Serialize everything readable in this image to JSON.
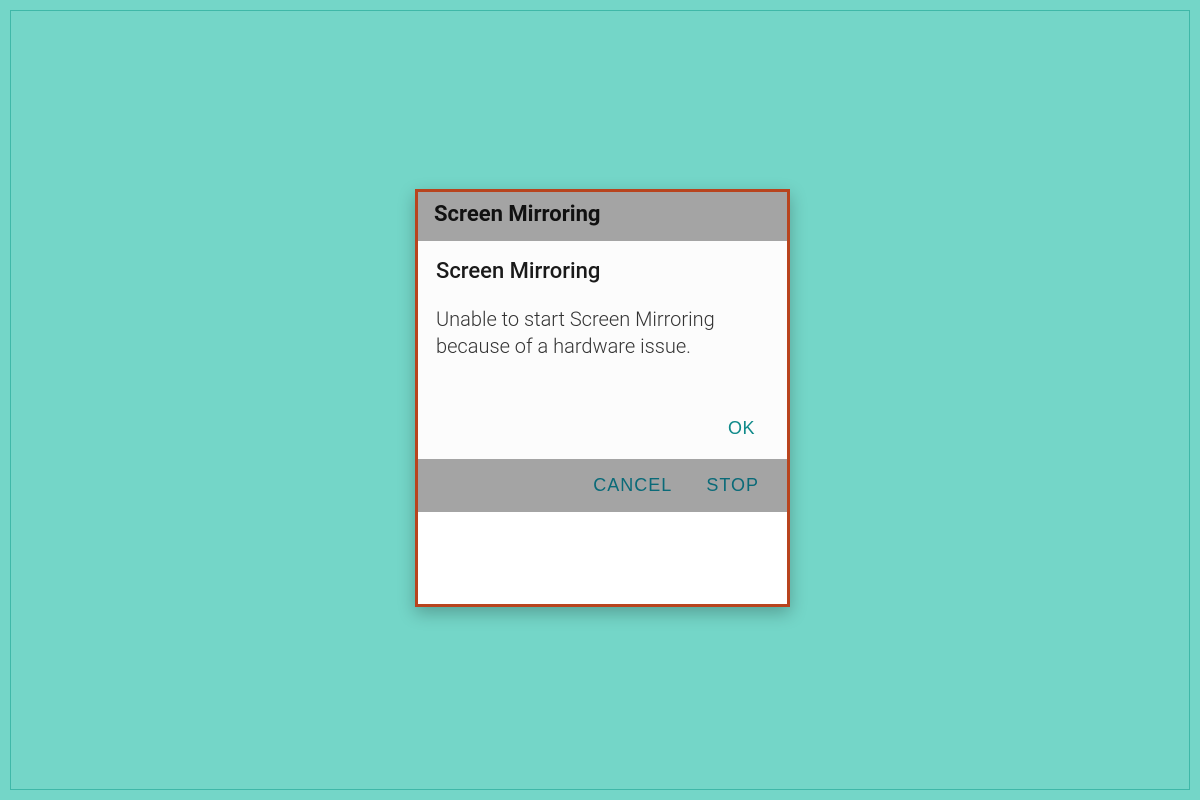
{
  "outer": {
    "title": "Screen Mirroring",
    "cancel_label": "CANCEL",
    "stop_label": "STOP"
  },
  "inner": {
    "title": "Screen Mirroring",
    "message": "Unable to start Screen Mirroring because of a hardware issue.",
    "ok_label": "OK"
  }
}
